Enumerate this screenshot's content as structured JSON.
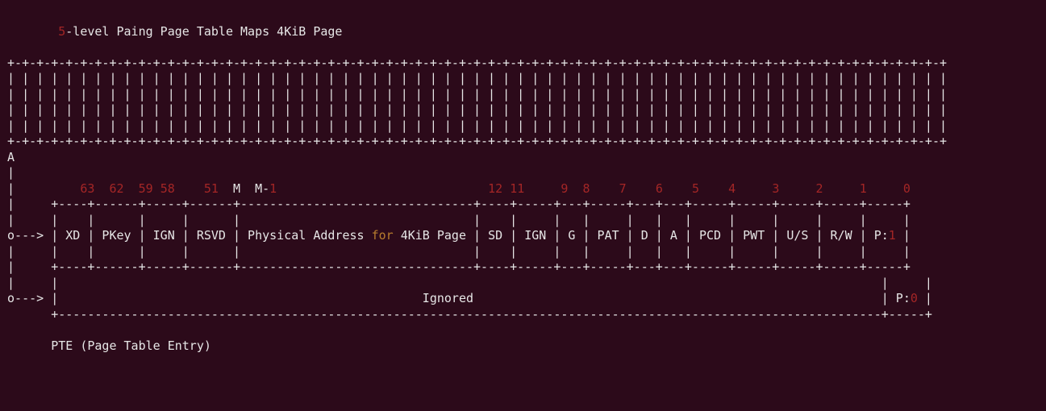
{
  "header": {
    "prefix_num": "5",
    "title_rest": "-level Paing Page Table Maps 4KiB Page"
  },
  "diagram": {
    "rule_top": " +-+-+-+-+-+-+-+-+-+-+-+-+-+-+-+-+-+-+-+-+-+-+-+-+-+-+-+-+-+-+-+-+-+-+-+-+-+-+-+-+-+-+-+-+-+-+-+-+-+-+-+-+-+-+-+-+-+-+-+-+-+-+-+-+",
    "rule_body1": " | | | | | | | | | | | | | | | | | | | | | | | | | | | | | | | | | | | | | | | | | | | | | | | | | | | | | | | | | | | | | | | | |",
    "anchor": " A",
    "pipe": " |",
    "bit_line_a": " |         ",
    "bit_63": "63",
    "bit_sp1": "  ",
    "bit_62": "62",
    "bit_sp2": "  ",
    "bit_59": "59",
    "bit_sp3": " ",
    "bit_58": "58",
    "bit_sp4": "    ",
    "bit_51": "51",
    "bit_sp5": "  ",
    "bit_M": "M  M-",
    "bit_1m": "1",
    "bit_gap": "                             ",
    "bit_12": "12",
    "bit_sp6": " ",
    "bit_11": "11",
    "bit_sp7": "     ",
    "bit_9": "9",
    "bit_sp8": "  ",
    "bit_8": "8",
    "bit_sp9": "    ",
    "bit_7": "7",
    "bit_sp10": "    ",
    "bit_6": "6",
    "bit_sp11": "    ",
    "bit_5": "5",
    "bit_sp12": "    ",
    "bit_4": "4",
    "bit_sp13": "     ",
    "bit_3": "3",
    "bit_sp14": "     ",
    "bit_2": "2",
    "bit_sp15": "     ",
    "bit_1": "1",
    "bit_sp16": "     ",
    "bit_0": "0",
    "frame_top": " |     +----+------+-----+------+--------------------------------+----+-----+---+-----+---+---+-----+-----+-----+-----+-----+",
    "frame_mid": " |     |    |      |     |      |                                |    |     |   |     |   |   |     |     |     |     |     |",
    "row_a1": " o---> | XD | PKey | IGN | RSVD | Physical Address ",
    "row_a2": " 4KiB Page | SD | IGN | G | PAT | D | A | PCD | PWT | U/S | R/W | P:",
    "row_a_one": "1",
    "row_a_end": " |",
    "for": "for",
    "frame_bot": " |     +----+------+-----+------+--------------------------------+----+-----+---+-----+---+---+-----+-----+-----+-----+-----+",
    "gap_row": " |     |                                                                                                                 |     |",
    "row_b1": " o---> |                                                  Ignored                                                        | P:",
    "row_b_zero": "0",
    "row_b_end": " |",
    "last_rule": "       +-----------------------------------------------------------------------------------------------------------------+-----+",
    "footer": "       PTE (Page Table Entry)"
  }
}
